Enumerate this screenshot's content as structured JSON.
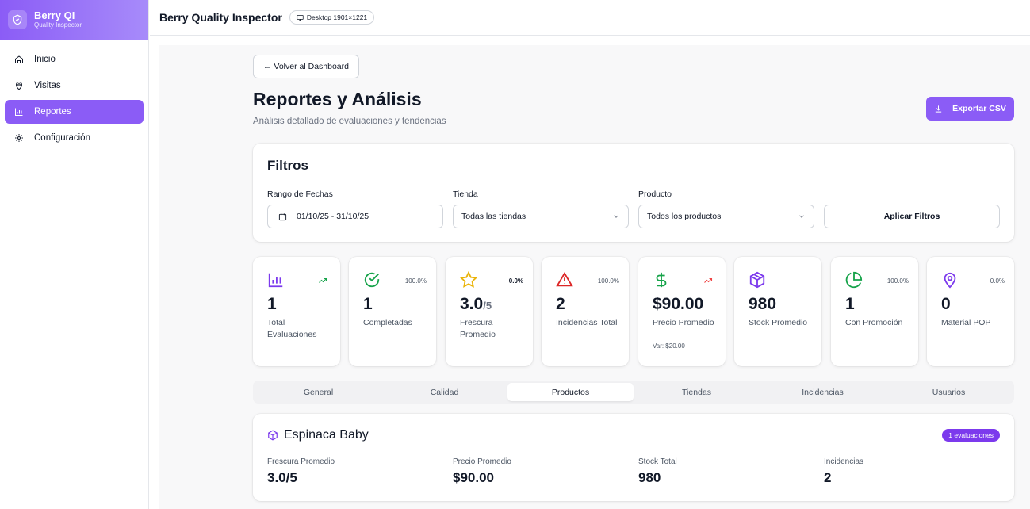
{
  "brand": {
    "title": "Berry QI",
    "subtitle": "Quality Inspector"
  },
  "nav": [
    {
      "label": "Inicio",
      "icon": "home-icon",
      "active": false
    },
    {
      "label": "Visitas",
      "icon": "map-pin-icon",
      "active": false
    },
    {
      "label": "Reportes",
      "icon": "bar-chart-icon",
      "active": true
    },
    {
      "label": "Configuración",
      "icon": "gear-icon",
      "active": false
    }
  ],
  "topbar": {
    "title": "Berry Quality Inspector",
    "device": "Desktop 1901×1221"
  },
  "page": {
    "back": "← Volver al Dashboard",
    "title": "Reportes y Análisis",
    "subtitle": "Análisis detallado de evaluaciones y tendencias",
    "export": "Exportar CSV"
  },
  "filters": {
    "title": "Filtros",
    "date_label": "Rango de Fechas",
    "date_value": "01/10/25 - 31/10/25",
    "store_label": "Tienda",
    "store_value": "Todas las tiendas",
    "product_label": "Producto",
    "product_value": "Todos los productos",
    "apply": "Aplicar Filtros"
  },
  "kpis": [
    {
      "value": "1",
      "label": "Total Evaluaciones",
      "badge": "",
      "icon": "bar-chart-icon",
      "color": "#7c3aed",
      "trend": "up",
      "trend_color": "#16a34a"
    },
    {
      "value": "1",
      "label": "Completadas",
      "badge": "100.0%",
      "icon": "check-circle-icon",
      "color": "#16a34a"
    },
    {
      "value": "3.0",
      "unit": "/5",
      "label": "Frescura Promedio",
      "badge": "0.0%",
      "icon": "star-icon",
      "color": "#eab308"
    },
    {
      "value": "2",
      "label": "Incidencias Total",
      "badge": "100.0%",
      "icon": "alert-triangle-icon",
      "color": "#dc2626"
    },
    {
      "value": "$90.00",
      "label": "Precio Promedio",
      "sub": "Var: $20.00",
      "icon": "dollar-icon",
      "color": "#16a34a",
      "trend": "up",
      "trend_color": "#ef4444"
    },
    {
      "value": "980",
      "label": "Stock Promedio",
      "badge": "",
      "icon": "package-icon",
      "color": "#7c3aed"
    },
    {
      "value": "1",
      "label": "Con Promoción",
      "badge": "100.0%",
      "icon": "pie-chart-icon",
      "color": "#16a34a"
    },
    {
      "value": "0",
      "label": "Material POP",
      "badge": "0.0%",
      "icon": "map-pin-icon",
      "color": "#7c3aed"
    }
  ],
  "tabs": [
    {
      "label": "General",
      "active": false
    },
    {
      "label": "Calidad",
      "active": false
    },
    {
      "label": "Productos",
      "active": true
    },
    {
      "label": "Tiendas",
      "active": false
    },
    {
      "label": "Incidencias",
      "active": false
    },
    {
      "label": "Usuarios",
      "active": false
    }
  ],
  "product": {
    "name": "Espinaca Baby",
    "badge": "1 evaluaciones",
    "stats": [
      {
        "label": "Frescura Promedio",
        "value": "3.0/5"
      },
      {
        "label": "Precio Promedio",
        "value": "$90.00"
      },
      {
        "label": "Stock Total",
        "value": "980"
      },
      {
        "label": "Incidencias",
        "value": "2"
      }
    ]
  }
}
